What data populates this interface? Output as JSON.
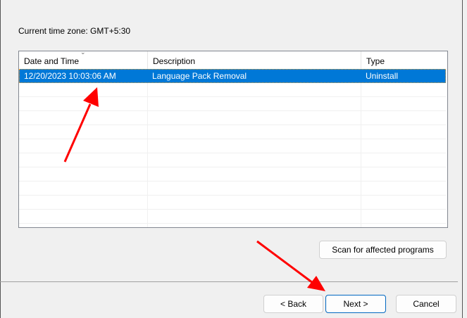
{
  "timezone_label": "Current time zone: GMT+5:30",
  "table": {
    "columns": [
      "Date and Time",
      "Description",
      "Type"
    ],
    "rows": [
      {
        "date": "12/20/2023 10:03:06 AM",
        "description": "Language Pack Removal",
        "type": "Uninstall",
        "selected": true
      }
    ]
  },
  "buttons": {
    "scan": "Scan for affected programs",
    "back": "< Back",
    "next": "Next >",
    "cancel": "Cancel"
  },
  "colors": {
    "selection": "#0078d7",
    "annotation_arrow": "#ff0000"
  }
}
